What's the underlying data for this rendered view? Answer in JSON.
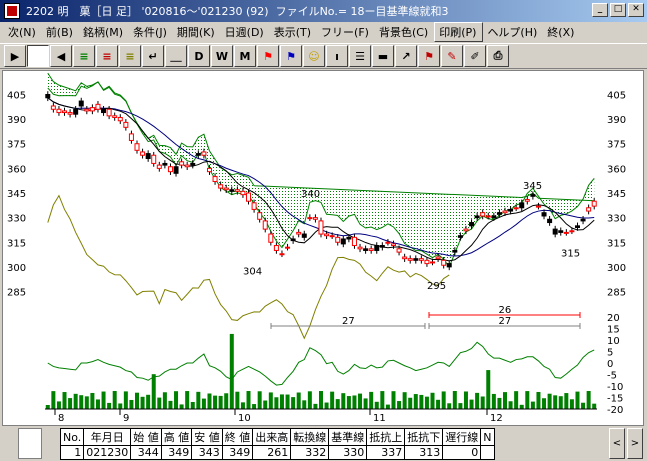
{
  "window": {
    "title": "2202 明　菓［日 足］ '020816～'021230 (92)  ファイルNo.= 18ー目基準線就和3",
    "min_label": "_",
    "max_label": "□",
    "close_label": "✕"
  },
  "menu": [
    {
      "label": "次(N)"
    },
    {
      "label": "前(B)"
    },
    {
      "label": "銘柄(M)"
    },
    {
      "label": "条件(J)"
    },
    {
      "label": "期間(K)"
    },
    {
      "label": "日週(D)"
    },
    {
      "label": "表示(T)"
    },
    {
      "label": "フリー(F)"
    },
    {
      "label": "背景色(C)"
    },
    {
      "label": "印刷(P)"
    },
    {
      "label": "ヘルプ(H)"
    },
    {
      "label": "終(X)"
    }
  ],
  "toolbar": [
    {
      "label": "▶",
      "name": "play-icon"
    },
    {
      "label": "",
      "name": "blank-page-icon"
    },
    {
      "label": "◀",
      "name": "back-icon"
    },
    {
      "label": "≡",
      "name": "signal-green-icon"
    },
    {
      "label": "≡",
      "name": "signal-red-icon"
    },
    {
      "label": "≡",
      "name": "signal-yellow-icon"
    },
    {
      "label": "↵",
      "name": "return-icon"
    },
    {
      "label": "＿",
      "name": "underline-icon"
    },
    {
      "label": "D",
      "name": "daily-icon"
    },
    {
      "label": "W",
      "name": "weekly-icon"
    },
    {
      "label": "M",
      "name": "monthly-icon"
    },
    {
      "label": "⚑",
      "name": "flag-red-icon"
    },
    {
      "label": "⚑",
      "name": "flag-blue-icon"
    },
    {
      "label": "☺",
      "name": "smiley-icon"
    },
    {
      "label": "ı",
      "name": "info-icon"
    },
    {
      "label": "☰",
      "name": "list-icon"
    },
    {
      "label": "▬",
      "name": "bar-icon"
    },
    {
      "label": "↗",
      "name": "arrow-icon"
    },
    {
      "label": "⚑",
      "name": "flag-icon"
    },
    {
      "label": "✎",
      "name": "edit-icon"
    },
    {
      "label": "✐",
      "name": "pen-icon"
    },
    {
      "label": "⎙",
      "name": "printer-icon"
    }
  ],
  "colors": {
    "cloud_fill": "#008000",
    "candle_up": "#ff0000",
    "candle_down": "#000000",
    "base_line": "#000080",
    "conv_line": "#000000",
    "lag_line": "#808000",
    "volume": "#008000"
  },
  "chart_data": {
    "type": "candlestick",
    "price_axis": {
      "ticks": [
        "405",
        "390",
        "375",
        "360",
        "345",
        "330",
        "315",
        "300",
        "285"
      ],
      "values": [
        405,
        390,
        375,
        360,
        345,
        330,
        315,
        300,
        285
      ],
      "range": [
        278,
        412
      ]
    },
    "months": [
      "8",
      "9",
      "10",
      "11",
      "12"
    ],
    "annotations": [
      {
        "label": "340",
        "value": 340
      },
      {
        "label": "304",
        "value": 304
      },
      {
        "label": "295",
        "value": 295
      },
      {
        "label": "345",
        "value": 345
      },
      {
        "label": "315",
        "value": 315
      }
    ],
    "spans": [
      {
        "label": "26",
        "color": "#ff0000"
      },
      {
        "label": "27",
        "color": "#808080"
      },
      {
        "label": "27",
        "color": "#808080"
      }
    ],
    "osc_axis": {
      "ticks": [
        "20",
        "15",
        "10",
        "5",
        "0",
        "-5",
        "-10",
        "-15",
        "-20"
      ],
      "values": [
        20,
        15,
        10,
        5,
        0,
        -5,
        -10,
        -15,
        -20
      ]
    },
    "closes": [
      403,
      398,
      396,
      395,
      394,
      393,
      398,
      396,
      397,
      399,
      394,
      396,
      392,
      391,
      388,
      381,
      375,
      370,
      366,
      368,
      362,
      362,
      361,
      357,
      364,
      362,
      362,
      368,
      370,
      360,
      355,
      350,
      348,
      346,
      347,
      346,
      345,
      339,
      333,
      328,
      320,
      313,
      308,
      312,
      316,
      321,
      318,
      330,
      330,
      328,
      320,
      319,
      318,
      314,
      317,
      318,
      312,
      310,
      311,
      310,
      312,
      315,
      314,
      311,
      306,
      305,
      304,
      305,
      304,
      303,
      306,
      304,
      300,
      309,
      318,
      323,
      325,
      330,
      333,
      331,
      330,
      332,
      334,
      334,
      336,
      336,
      341,
      343,
      337,
      331,
      327,
      320,
      321,
      321,
      322,
      324,
      328,
      336,
      340
    ],
    "opens": [
      405,
      396,
      394,
      394,
      393,
      396,
      401,
      395,
      395,
      396,
      396,
      392,
      391,
      389,
      385,
      377,
      371,
      368,
      369,
      363,
      360,
      363,
      358,
      361,
      362,
      361,
      363,
      369,
      368,
      358,
      352,
      348,
      347,
      347,
      346,
      344,
      340,
      335,
      329,
      323,
      315,
      310,
      308,
      312,
      317,
      320,
      320,
      330,
      329,
      320,
      319,
      319,
      315,
      317,
      318,
      313,
      311,
      311,
      310,
      313,
      313,
      315,
      313,
      309,
      305,
      304,
      305,
      304,
      302,
      303,
      305,
      301,
      302,
      310,
      319,
      322,
      327,
      331,
      331,
      331,
      331,
      333,
      333,
      335,
      336,
      339,
      340,
      344,
      337,
      333,
      329,
      323,
      322,
      321,
      322,
      325,
      329,
      334,
      337
    ]
  },
  "status": {
    "headers": [
      "No.",
      "年月日",
      "始 値",
      "高 値",
      "安 値",
      "終 値",
      "出来高",
      "転換線",
      "基準線",
      "抵抗上",
      "抵抗下",
      "遅行線",
      "N"
    ],
    "values": [
      "1",
      "021230",
      "344",
      "349",
      "343",
      "349",
      "261",
      "332",
      "330",
      "337",
      "313",
      "0",
      ""
    ]
  }
}
